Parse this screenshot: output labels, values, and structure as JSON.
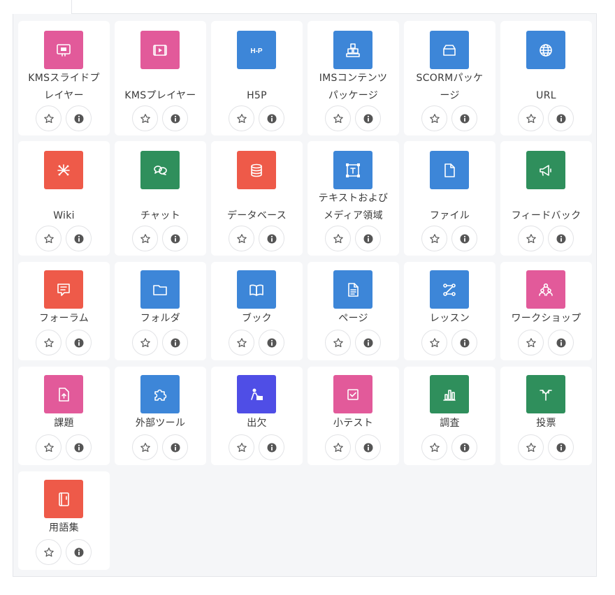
{
  "colors": {
    "pink": "#e25a9a",
    "blue": "#3d86d8",
    "red": "#ee5a49",
    "green": "#2f8f5c",
    "purple": "#4f4ee6"
  },
  "items": [
    {
      "name": "KMSスライドプ\nレイヤー",
      "icon": "slides-player-icon",
      "color": "pink"
    },
    {
      "name": "KMSプレイヤー",
      "icon": "video-player-icon",
      "color": "pink"
    },
    {
      "name": "H5P",
      "icon": "h5p-icon",
      "color": "blue"
    },
    {
      "name": "IMSコンテンツ\nパッケージ",
      "icon": "ims-package-icon",
      "color": "blue"
    },
    {
      "name": "SCORMパッケ\nージ",
      "icon": "scorm-package-icon",
      "color": "blue"
    },
    {
      "name": "URL",
      "icon": "globe-icon",
      "color": "blue"
    },
    {
      "name": "Wiki",
      "icon": "wiki-network-icon",
      "color": "red"
    },
    {
      "name": "チャット",
      "icon": "chat-bubbles-icon",
      "color": "green"
    },
    {
      "name": "データベース",
      "icon": "database-icon",
      "color": "red"
    },
    {
      "name": "テキストおよび\nメディア領域",
      "icon": "text-media-icon",
      "color": "blue"
    },
    {
      "name": "ファイル",
      "icon": "file-icon",
      "color": "blue"
    },
    {
      "name": "フィードバック",
      "icon": "megaphone-icon",
      "color": "green"
    },
    {
      "name": "フォーラム",
      "icon": "forum-icon",
      "color": "red"
    },
    {
      "name": "フォルダ",
      "icon": "folder-icon",
      "color": "blue"
    },
    {
      "name": "ブック",
      "icon": "book-icon",
      "color": "blue"
    },
    {
      "name": "ページ",
      "icon": "page-icon",
      "color": "blue"
    },
    {
      "name": "レッスン",
      "icon": "lesson-icon",
      "color": "blue"
    },
    {
      "name": "ワークショップ",
      "icon": "workshop-icon",
      "color": "pink"
    },
    {
      "name": "課題",
      "icon": "assignment-icon",
      "color": "pink"
    },
    {
      "name": "外部ツール",
      "icon": "puzzle-icon",
      "color": "blue"
    },
    {
      "name": "出欠",
      "icon": "attendance-icon",
      "color": "purple"
    },
    {
      "name": "小テスト",
      "icon": "quiz-icon",
      "color": "pink"
    },
    {
      "name": "調査",
      "icon": "survey-chart-icon",
      "color": "green"
    },
    {
      "name": "投票",
      "icon": "choice-icon",
      "color": "green"
    },
    {
      "name": "用語集",
      "icon": "glossary-icon",
      "color": "red"
    }
  ],
  "actions": {
    "star_icon": "star-icon",
    "info_icon": "info-icon"
  }
}
